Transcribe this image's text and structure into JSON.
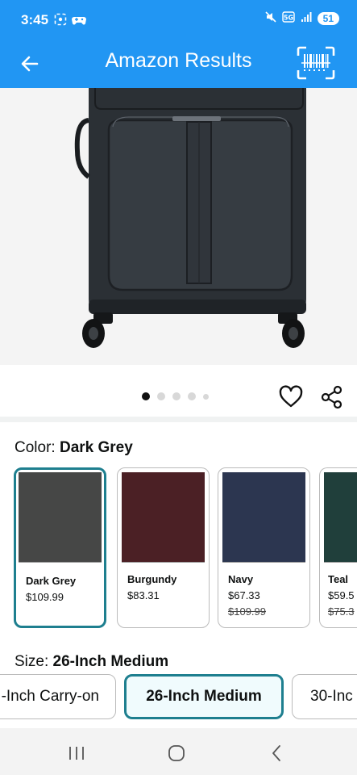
{
  "status_bar": {
    "time": "3:45",
    "battery": "51",
    "icons": [
      "screenshot-icon",
      "game-controller-icon",
      "mute-icon",
      "5g-icon",
      "signal-icon"
    ]
  },
  "app_bar": {
    "title": "Amazon Results",
    "icons": [
      "back-arrow-icon",
      "barcode-scan-icon"
    ]
  },
  "product_image": {
    "subject": "dark grey softside spinner suitcase",
    "carousel_total": 5,
    "carousel_active": 1
  },
  "color": {
    "label": "Color:",
    "selected": "Dark Grey",
    "swatches": [
      {
        "name": "Dark Grey",
        "price": "$109.99",
        "original_price": "",
        "hex": "#464746",
        "selected": true
      },
      {
        "name": "Burgundy",
        "price": "$83.31",
        "original_price": "",
        "hex": "#4b2025",
        "selected": false
      },
      {
        "name": "Navy",
        "price": "$67.33",
        "original_price": "$109.99",
        "hex": "#2c3650",
        "selected": false
      },
      {
        "name": "Teal",
        "price": "$59.5",
        "original_price": "$75.3",
        "hex": "#203f3b",
        "selected": false
      }
    ]
  },
  "size": {
    "label": "Size:",
    "selected": "26-Inch Medium",
    "options": [
      "-Inch Carry-on",
      "26-Inch Medium",
      "30-Inc"
    ]
  },
  "colors": {
    "app_bar": "#2196f3",
    "selection_border": "#1e7f8f"
  }
}
